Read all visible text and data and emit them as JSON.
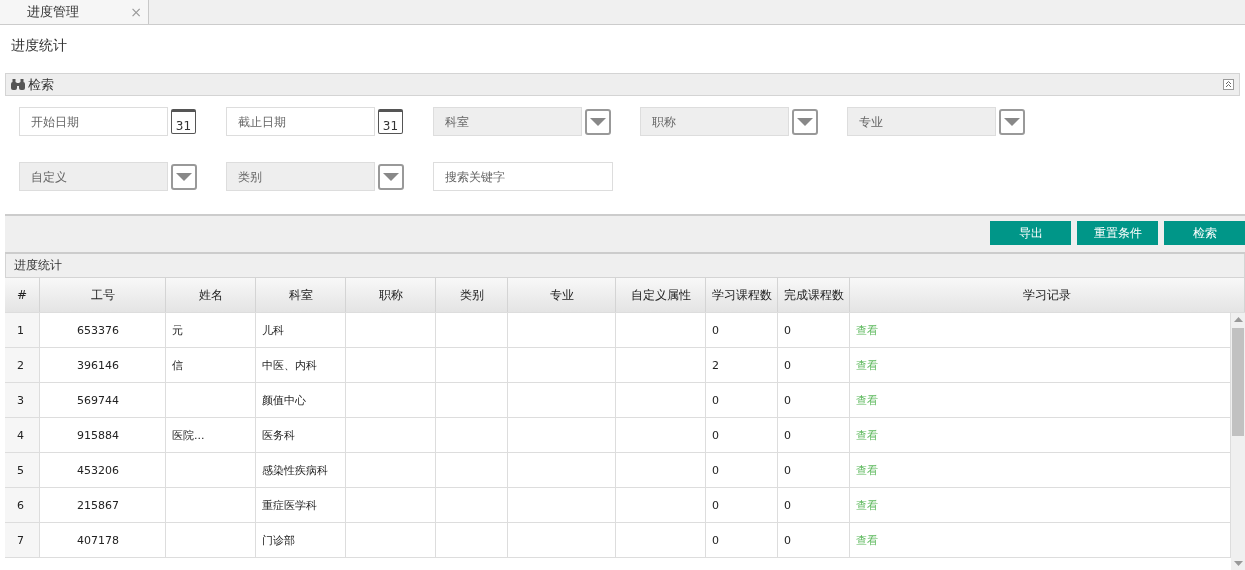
{
  "tabs": [
    {
      "label": "进度管理",
      "selected": true,
      "close": "×"
    }
  ],
  "page_title": "进度统计",
  "search_panel": {
    "title": "检索",
    "filters": [
      {
        "kind": "date",
        "placeholder": "开始日期",
        "icon_text": "31"
      },
      {
        "kind": "date",
        "placeholder": "截止日期",
        "icon_text": "31"
      },
      {
        "kind": "select",
        "placeholder": "科室"
      },
      {
        "kind": "select",
        "placeholder": "职称"
      },
      {
        "kind": "select",
        "placeholder": "专业"
      },
      {
        "kind": "select",
        "placeholder": "自定义"
      },
      {
        "kind": "select",
        "placeholder": "类别"
      },
      {
        "kind": "text",
        "placeholder": "搜索关键字"
      }
    ]
  },
  "buttons": [
    "导出",
    "重置条件",
    "检索"
  ],
  "table": {
    "title": "进度统计",
    "columns": [
      "#",
      "工号",
      "姓名",
      "科室",
      "职称",
      "类别",
      "专业",
      "自定义属性",
      "学习课程数",
      "完成课程数",
      "学习记录"
    ],
    "rows": [
      [
        "1",
        "653376",
        "元",
        "儿科",
        "",
        "",
        "",
        "",
        "0",
        "0",
        "查看"
      ],
      [
        "2",
        "396146",
        "信",
        "中医、内科",
        "",
        "",
        "",
        "",
        "2",
        "0",
        "查看"
      ],
      [
        "3",
        "569744",
        "",
        "颜值中心",
        "",
        "",
        "",
        "",
        "0",
        "0",
        "查看"
      ],
      [
        "4",
        "915884",
        "医院...",
        "医务科",
        "",
        "",
        "",
        "",
        "0",
        "0",
        "查看"
      ],
      [
        "5",
        "453206",
        "",
        "感染性疾病科",
        "",
        "",
        "",
        "",
        "0",
        "0",
        "查看"
      ],
      [
        "6",
        "215867",
        "",
        "重症医学科",
        "",
        "",
        "",
        "",
        "0",
        "0",
        "查看"
      ],
      [
        "7",
        "407178",
        "",
        "门诊部",
        "",
        "",
        "",
        "",
        "0",
        "0",
        "查看"
      ]
    ]
  }
}
